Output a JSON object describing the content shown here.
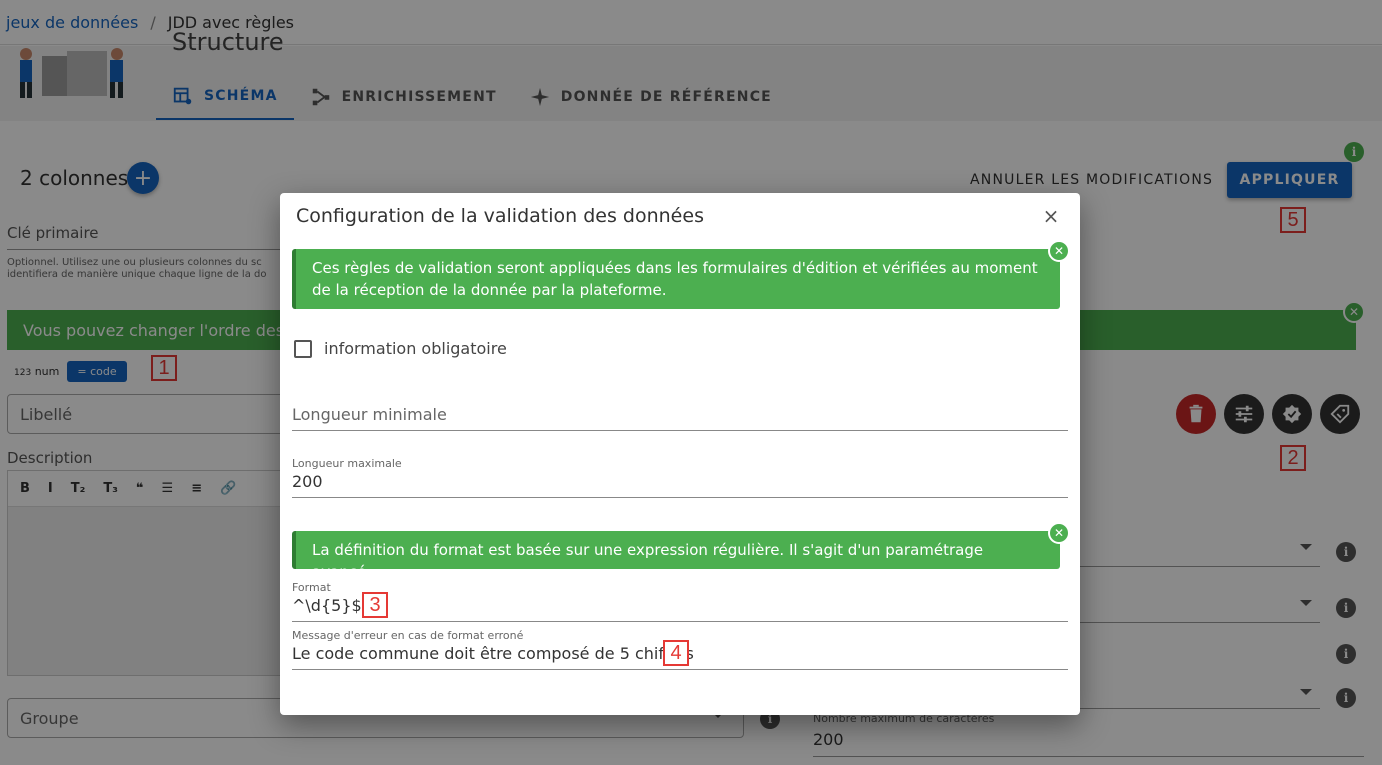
{
  "breadcrumb": {
    "link": "jeux de données",
    "separator": "/",
    "current": "JDD avec règles"
  },
  "header": {
    "title": "Structure",
    "tabs": [
      {
        "label": "SCHÉMA",
        "icon": "schema-icon",
        "active": true
      },
      {
        "label": "ENRICHISSEMENT",
        "icon": "enrichment-icon",
        "active": false
      },
      {
        "label": "DONNÉE DE RÉFÉRENCE",
        "icon": "sparkle-icon",
        "active": false
      }
    ]
  },
  "columns": {
    "title": "2 colonnes",
    "add_icon": "+"
  },
  "actions": {
    "cancel": "ANNULER LES MODIFICATIONS",
    "apply": "APPLIQUER",
    "info": "i"
  },
  "primary_key": {
    "label": "Clé primaire",
    "hint_line1": "Optionnel. Utilisez une ou plusieurs colonnes du sc",
    "hint_line2": "identifiera de manière unique chaque ligne de la do"
  },
  "order_banner": {
    "text": "Vous pouvez changer l'ordre des col"
  },
  "chips": {
    "num_icon": "123",
    "num": "num",
    "code_icon": "=",
    "code": "code"
  },
  "form": {
    "libelle": "Libellé",
    "description": "Description",
    "toolbar": [
      "B",
      "I",
      "T₂",
      "T₃",
      "❝",
      "☰",
      "≡",
      "🔗"
    ],
    "groupe": "Groupe",
    "nbmax_label": "Nombre maximum de caractères",
    "nbmax_value": "200"
  },
  "annotations": {
    "n1": "1",
    "n2": "2",
    "n3": "3",
    "n4": "4",
    "n5": "5"
  },
  "dialog": {
    "title": "Configuration de la validation des données",
    "close_icon": "×",
    "alert1": "Ces règles de validation seront appliquées dans les formulaires d'édition et vérifiées au moment de la réception de la donnée par la plateforme.",
    "checkbox_label": "information obligatoire",
    "checkbox_checked": false,
    "min_length_label": "Longueur minimale",
    "min_length_value": "",
    "max_length_label": "Longueur maximale",
    "max_length_value": "200",
    "alert2": "La définition du format est basée sur une expression régulière. Il s'agit d'un paramétrage avancé.",
    "format_label": "Format",
    "format_value": "^\\d{5}$",
    "error_label": "Message d'erreur en cas de format erroné",
    "error_value": "Le code commune doit être composé de 5 chiffres"
  },
  "colors": {
    "primary": "#1565c0",
    "success": "#4caf50",
    "danger": "#c62828",
    "dark": "#333333",
    "annotation": "#e53935"
  }
}
